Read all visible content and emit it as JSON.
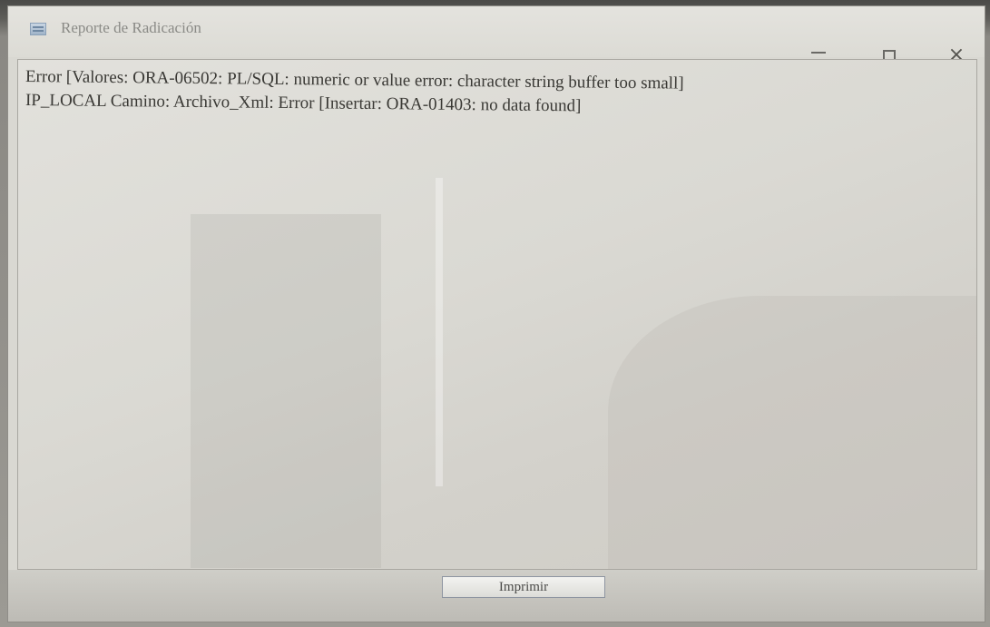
{
  "window": {
    "title": "Reporte de Radicación",
    "icon": "app-window-icon"
  },
  "controls": {
    "minimize_icon": "minimize-icon",
    "maximize_icon": "maximize-icon",
    "close_glyph": "×"
  },
  "report": {
    "line1": "Error [Valores: ORA-06502: PL/SQL: numeric or value error: character string buffer too small]",
    "line2": "IP_LOCAL Camino: Archivo_Xml: Error [Insertar: ORA-01403: no data found]"
  },
  "actions": {
    "print_label": "Imprimir"
  }
}
